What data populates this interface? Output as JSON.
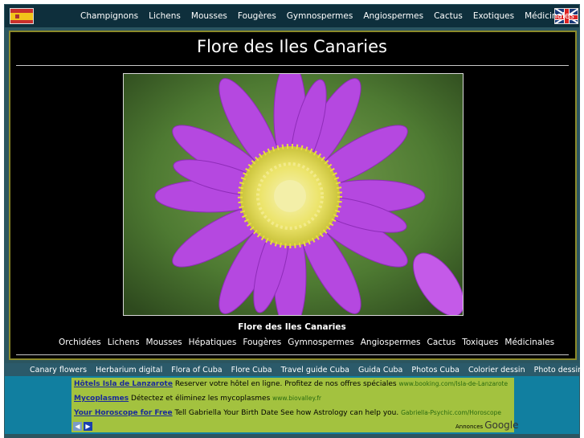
{
  "topnav": {
    "items": [
      "Champignons",
      "Lichens",
      "Mousses",
      "Fougères",
      "Gymnospermes",
      "Angiospermes",
      "Cactus",
      "Exotiques",
      "Médicinales"
    ]
  },
  "main": {
    "title": "Flore des Iles Canaries",
    "caption": "Flore des Iles Canaries",
    "nav": [
      "Orchidées",
      "Lichens",
      "Mousses",
      "Hépatiques",
      "Fougères",
      "Gymnospermes",
      "Angiospermes",
      "Cactus",
      "Toxiques",
      "Médicinales"
    ]
  },
  "links": [
    "Canary flowers",
    "Herbarium digital",
    "Flora of Cuba",
    "Flore Cuba",
    "Travel guide Cuba",
    "Guida Cuba",
    "Photos Cuba",
    "Colorier dessin",
    "Photo dessin"
  ],
  "ads": [
    {
      "title": "Hôtels Isla de Lanzarote",
      "text": "Reserver votre hôtel en ligne. Profitez de nos offres spéciales",
      "url": "www.booking.com/Isla-de-Lanzarote"
    },
    {
      "title": "Mycoplasmes",
      "text": "Détectez et éliminez les mycoplasmes",
      "url": "www.biovalley.fr"
    },
    {
      "title": "Your Horoscope for Free",
      "text": "Tell Gabriella Your Birth Date See how Astrology can help you.",
      "url": "Gabriella-Psychic.com/Horoscope"
    }
  ],
  "adbrand": {
    "label": "Annonces",
    "name": "Google"
  },
  "colors": {
    "accent": "#8c8a2a",
    "nav_bg": "#0e2f3c",
    "ad_bg": "#a3c23f",
    "teal": "#117fa0",
    "petal": "#b548e0"
  },
  "icons": {
    "flag_left": "spain-flag-icon",
    "flag_right": "uk-flag-icon",
    "prev": "arrow-left-icon",
    "next": "arrow-right-icon"
  }
}
